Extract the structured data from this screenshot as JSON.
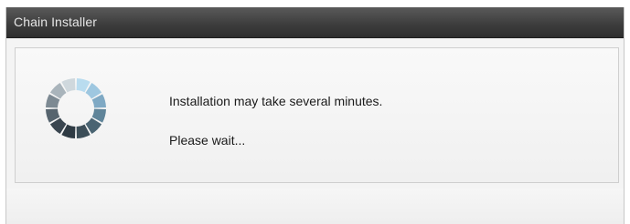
{
  "window": {
    "title": "Chain Installer"
  },
  "dialog": {
    "message_line1": "Installation may take several minutes.",
    "message_line2": "Please wait...",
    "spinner_icon": "loading-spinner-icon"
  },
  "colors": {
    "titlebar": "#3e3e3e",
    "title_text": "#e6e6e6",
    "panel_background": "#f4f4f4",
    "spinner_light": "#9ec7e0",
    "spinner_dark": "#2f3b44"
  }
}
